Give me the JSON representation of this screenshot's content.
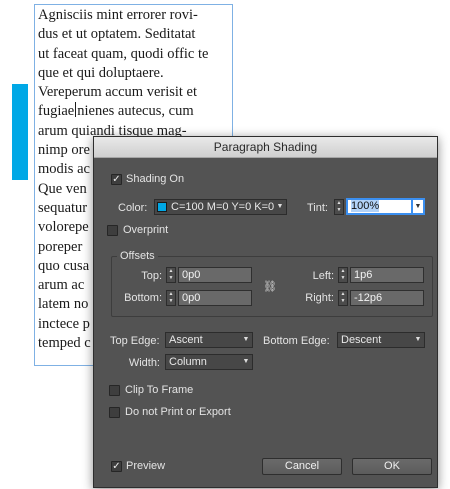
{
  "document": {
    "lines": [
      "Agnisciis mint errorer rovi-",
      "dus et ut optatem. Seditatat",
      "ut faceat quam, quodi offic te",
      "que et qui doluptaere.",
      "Vereperum accum verisit et",
      "fugiae",
      "nienes autecus, cum",
      "arum quiandi tisque mag-",
      "nimp ore",
      "modis ac",
      "Que ven",
      "sequatur",
      "volorepe",
      "poreper",
      "quo cusa",
      "arum ac",
      "latem no",
      "inctece p",
      "temped c"
    ],
    "shading_color": "#00a8e6"
  },
  "dialog": {
    "title": "Paragraph Shading",
    "shading_on": {
      "label": "Shading On",
      "checked": true
    },
    "color": {
      "label": "Color:",
      "value": "C=100 M=0 Y=0 K=0",
      "swatch": "#00a8e6"
    },
    "tint": {
      "label": "Tint:",
      "value": "100%"
    },
    "overprint": {
      "label": "Overprint",
      "checked": false
    },
    "offsets": {
      "title": "Offsets",
      "top": {
        "label": "Top:",
        "value": "0p0"
      },
      "bottom": {
        "label": "Bottom:",
        "value": "0p0"
      },
      "left": {
        "label": "Left:",
        "value": "1p6"
      },
      "right": {
        "label": "Right:",
        "value": "-12p6"
      },
      "link_icon": "chain-link-icon"
    },
    "top_edge": {
      "label": "Top Edge:",
      "value": "Ascent"
    },
    "bottom_edge": {
      "label": "Bottom Edge:",
      "value": "Descent"
    },
    "width": {
      "label": "Width:",
      "value": "Column"
    },
    "clip_to_frame": {
      "label": "Clip To Frame",
      "checked": false
    },
    "do_not_print": {
      "label": "Do not Print or Export",
      "checked": false
    },
    "preview": {
      "label": "Preview",
      "checked": true
    },
    "cancel_label": "Cancel",
    "ok_label": "OK"
  }
}
